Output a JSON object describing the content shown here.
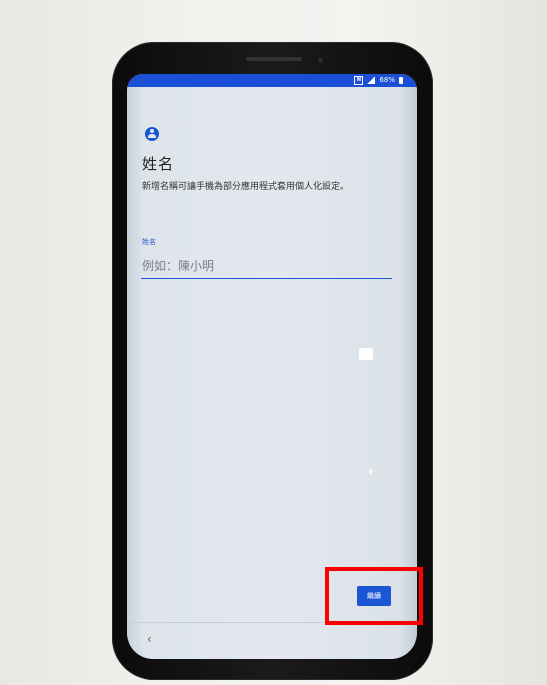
{
  "status_bar": {
    "battery_text": "68%",
    "nfc_label": "N",
    "accent_color": "#1a4fd6"
  },
  "screen": {
    "icon": "account-circle-icon",
    "title": "姓名",
    "description": "新增名稱可讓手機為部分應用程式套用個人化設定。",
    "field_label": "姓名",
    "name_placeholder": "例如：陳小明",
    "name_value": "",
    "continue_label": "繼續",
    "back_glyph": "‹"
  },
  "colors": {
    "accent": "#1b57d2",
    "highlight": "#ff0000"
  }
}
